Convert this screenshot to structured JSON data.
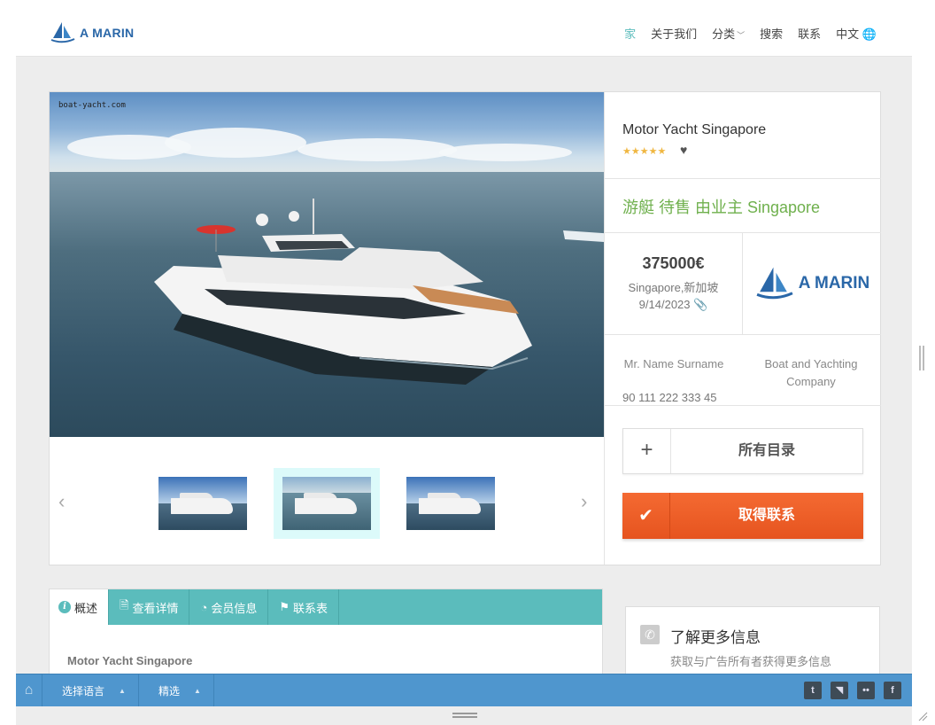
{
  "header": {
    "logo_text": "A MARIN",
    "nav": [
      "家",
      "关于我们",
      "分类",
      "搜索",
      "联系",
      "中文"
    ],
    "nav_active": "家"
  },
  "photo": {
    "watermark": "boat-yacht.com"
  },
  "listing": {
    "title": "Motor Yacht Singapore",
    "rating_stars": 5,
    "category_line": "游艇 待售 由业主 Singapore",
    "price": "375000€",
    "location": "Singapore,新加坡",
    "date": "9/14/2023",
    "brand_text": "A MARIN",
    "contact_name": "Mr. Name Surname",
    "contact_phone": "90 111 222 333 45",
    "company": "Boat and Yachting Company",
    "catalog_button": "所有目录",
    "contact_button": "取得联系"
  },
  "tabs": {
    "items": [
      "概述",
      "查看详情",
      "会员信息",
      "联系表"
    ],
    "active": "概述",
    "overview_title": "Motor Yacht Singapore"
  },
  "info_card": {
    "title": "了解更多信息",
    "subtitle": "获取与广告所有者获得更多信息"
  },
  "bottombar": {
    "language_label": "选择语言",
    "featured_label": "精选",
    "social": [
      "twitter-icon",
      "rss-icon",
      "flickr-icon",
      "facebook-icon"
    ]
  },
  "colors": {
    "accent_teal": "#5bbcbc",
    "brand_blue": "#2a67a8",
    "category_green": "#6fb04d",
    "cta_orange": "#f05f28",
    "star_gold": "#f0b742",
    "bottom_bar_blue": "#4f96ce"
  }
}
